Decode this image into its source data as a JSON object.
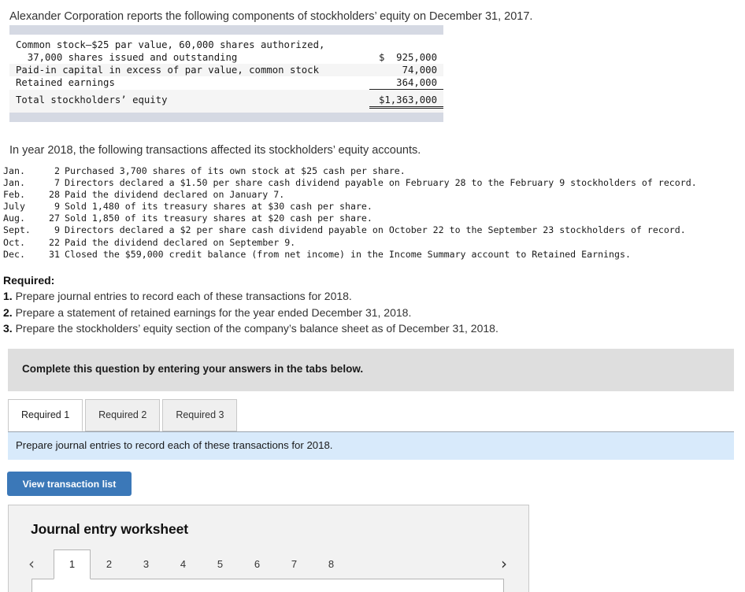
{
  "intro": {
    "line1": "Alexander Corporation reports the following components of stockholders’ equity on December 31, 2017.",
    "line2": "In year 2018, the following transactions affected its stockholders’ equity accounts."
  },
  "equity_table": {
    "rows": [
      {
        "label": "Common stock–$25 par value, 60,000 shares authorized,",
        "amount": "",
        "shaded": false,
        "rule": "none"
      },
      {
        "label": "  37,000 shares issued and outstanding",
        "amount": "$  925,000",
        "shaded": false,
        "rule": "none"
      },
      {
        "label": "Paid-in capital in excess of par value, common stock",
        "amount": "   74,000",
        "shaded": true,
        "rule": "none"
      },
      {
        "label": "Retained earnings",
        "amount": "  364,000",
        "shaded": false,
        "rule": "single"
      },
      {
        "label": "Total stockholders’ equity",
        "amount": "$1,363,000",
        "shaded": true,
        "rule": "double"
      }
    ]
  },
  "transactions": [
    {
      "month": "Jan.",
      "day": "2",
      "text": "Purchased 3,700 shares of its own stock at $25 cash per share."
    },
    {
      "month": "Jan.",
      "day": "7",
      "text": "Directors declared a $1.50 per share cash dividend payable on February 28 to the February 9 stockholders of record."
    },
    {
      "month": "Feb.",
      "day": "28",
      "text": "Paid the dividend declared on January 7."
    },
    {
      "month": "July",
      "day": "9",
      "text": "Sold 1,480 of its treasury shares at $30 cash per share."
    },
    {
      "month": "Aug.",
      "day": "27",
      "text": "Sold 1,850 of its treasury shares at $20 cash per share."
    },
    {
      "month": "Sept.",
      "day": "9",
      "text": "Directors declared a $2 per share cash dividend payable on October 22 to the September 23 stockholders of record."
    },
    {
      "month": "Oct.",
      "day": "22",
      "text": "Paid the dividend declared on September 9."
    },
    {
      "month": "Dec.",
      "day": "31",
      "text": "Closed the $59,000 credit balance (from net income) in the Income Summary account to Retained Earnings."
    }
  ],
  "required": {
    "title": "Required:",
    "items": [
      {
        "num": "1.",
        "text": "Prepare journal entries to record each of these transactions for 2018."
      },
      {
        "num": "2.",
        "text": "Prepare a statement of retained earnings for the year ended December 31, 2018."
      },
      {
        "num": "3.",
        "text": "Prepare the stockholders’ equity section of the company’s balance sheet as of December 31, 2018."
      }
    ]
  },
  "complete_banner": {
    "text": "Complete this question by entering your answers in the tabs below."
  },
  "tabs": [
    {
      "label": "Required 1",
      "active": true
    },
    {
      "label": "Required 2",
      "active": false
    },
    {
      "label": "Required 3",
      "active": false
    }
  ],
  "instruction_bar": {
    "text": "Prepare journal entries to record each of these transactions for 2018."
  },
  "view_transaction_button": {
    "label": "View transaction list"
  },
  "worksheet": {
    "title": "Journal entry worksheet",
    "prev_arrow": "‹",
    "next_arrow": "›",
    "pages": [
      {
        "label": "1",
        "active": true
      },
      {
        "label": "2",
        "active": false
      },
      {
        "label": "3",
        "active": false
      },
      {
        "label": "4",
        "active": false
      },
      {
        "label": "5",
        "active": false
      },
      {
        "label": "6",
        "active": false
      },
      {
        "label": "7",
        "active": false
      },
      {
        "label": "8",
        "active": false
      }
    ]
  },
  "colors": {
    "table_bar": "#d5d9e3",
    "row_shade": "#f5f5f5",
    "banner_gray": "#dedede",
    "instruction_blue": "#d8eafb",
    "button_blue": "#3b78b8",
    "panel_gray": "#f2f2f2"
  }
}
